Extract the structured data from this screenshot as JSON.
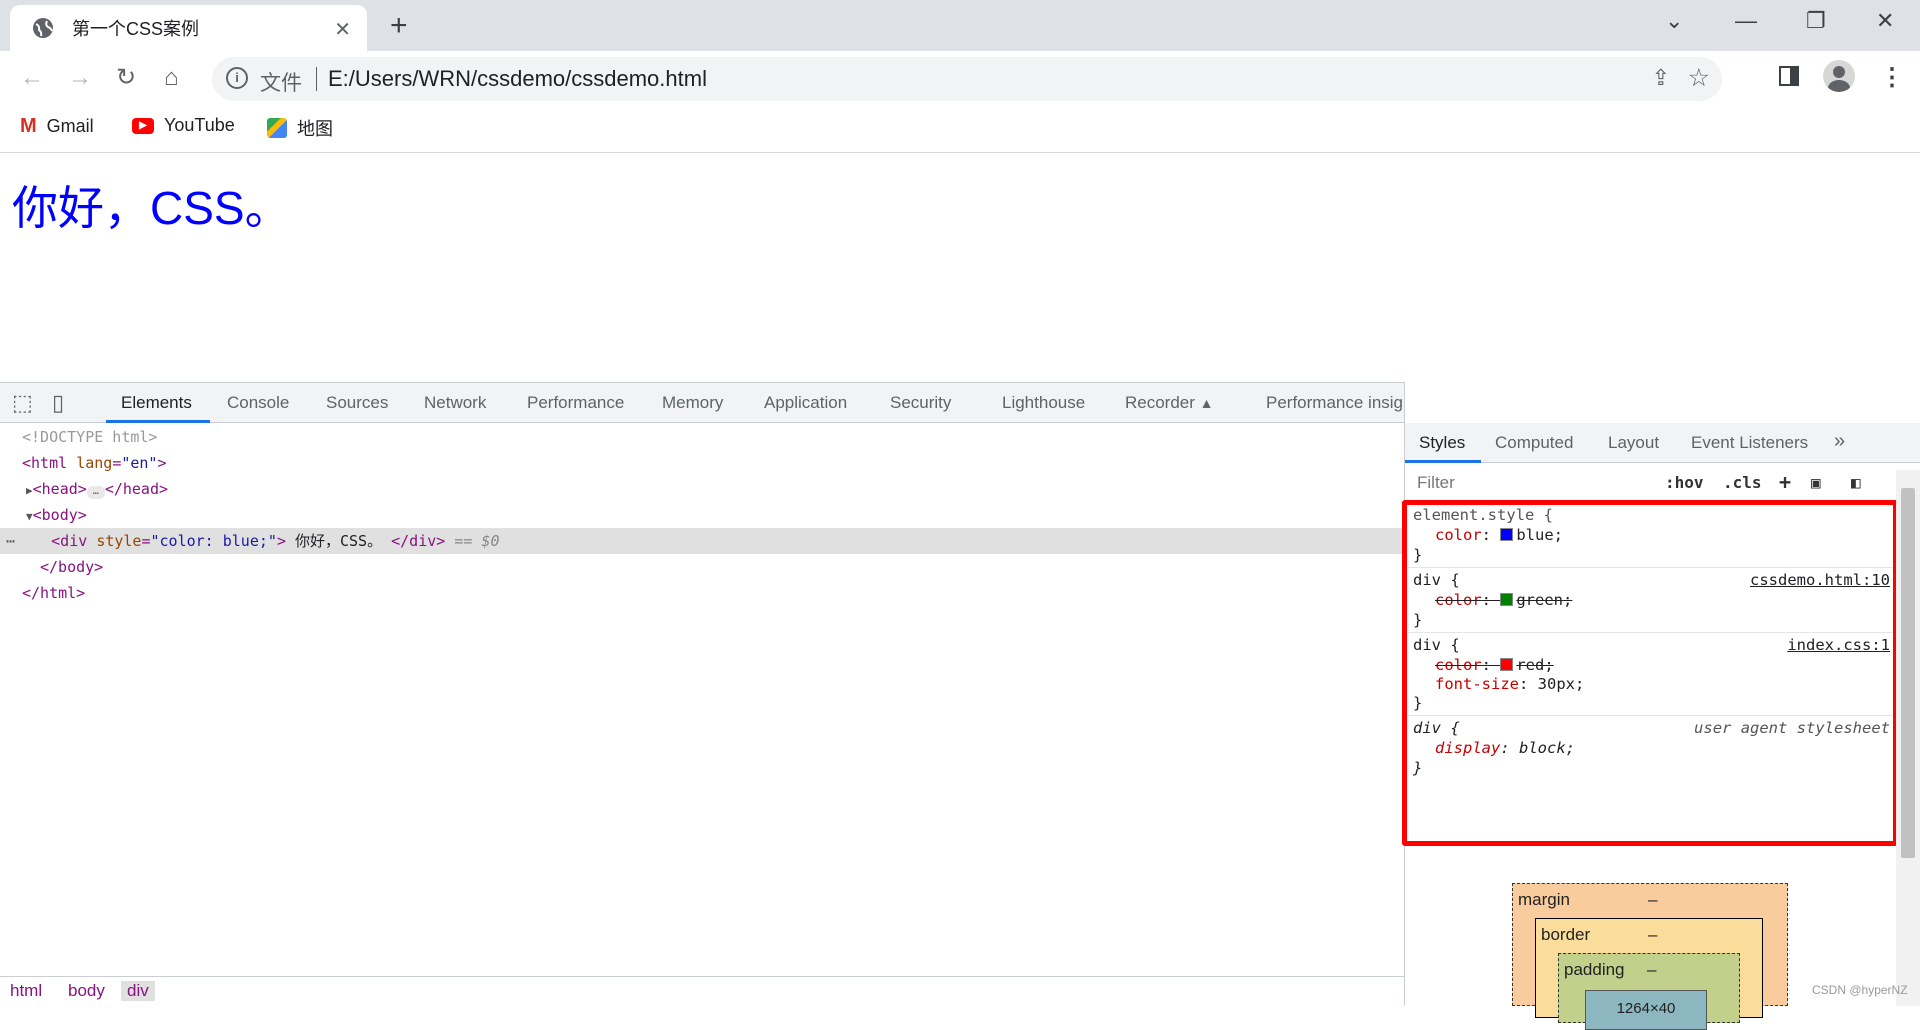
{
  "browser": {
    "tab_title": "第一个CSS案例",
    "url_scheme": "文件",
    "url": "E:/Users/WRN/cssdemo/cssdemo.html",
    "bookmarks": [
      {
        "label": "Gmail",
        "icon": "gmail-icon"
      },
      {
        "label": "YouTube",
        "icon": "youtube-icon"
      },
      {
        "label": "地图",
        "icon": "maps-icon"
      }
    ]
  },
  "page": {
    "text": "你好，CSS。",
    "text_color": "#0000ff"
  },
  "devtools": {
    "tabs": [
      "Elements",
      "Console",
      "Sources",
      "Network",
      "Performance",
      "Memory",
      "Application",
      "Security",
      "Lighthouse",
      "Recorder",
      "Performance insights"
    ],
    "active_tab": "Elements",
    "dom": {
      "doctype": "<!DOCTYPE html>",
      "html_open": "<html",
      "html_attr": "lang",
      "html_val": "\"en\"",
      "head": "<head>",
      "head_close": "</head>",
      "body_open": "<body>",
      "div_open": "<div",
      "div_attr": "style",
      "div_val": "\"color: blue;\"",
      "div_text": "你好，CSS。",
      "div_close": "</div>",
      "div_marker": "== $0",
      "body_close": "</body>",
      "html_close": "</html>"
    },
    "breadcrumbs": [
      "html",
      "body",
      "div"
    ],
    "styles_tabs": [
      "Styles",
      "Computed",
      "Layout",
      "Event Listeners"
    ],
    "filter_placeholder": "Filter",
    "hov": ":hov",
    "cls": ".cls",
    "rules": [
      {
        "selector": "element.style {",
        "props": [
          {
            "name": "color",
            "value": "blue;",
            "swatch": "#0000ff",
            "struck": false
          }
        ],
        "source": ""
      },
      {
        "selector": "div {",
        "props": [
          {
            "name": "color",
            "value": "green;",
            "swatch": "#008000",
            "struck": true
          }
        ],
        "source": "cssdemo.html:10"
      },
      {
        "selector": "div {",
        "props": [
          {
            "name": "color",
            "value": "red;",
            "swatch": "#ff0000",
            "struck": true
          },
          {
            "name": "font-size",
            "value": "30px;",
            "struck": false
          }
        ],
        "source": "index.css:1"
      },
      {
        "selector": "div {",
        "props": [
          {
            "name": "display",
            "value": "block;",
            "struck": false
          }
        ],
        "source": "user agent stylesheet"
      }
    ],
    "close_brace": "}",
    "box_model": {
      "margin": "margin",
      "margin_val": "–",
      "border": "border",
      "border_val": "–",
      "padding": "padding",
      "padding_val": "–",
      "content": "1264×40"
    }
  },
  "watermark": "CSDN @hyperNZ"
}
